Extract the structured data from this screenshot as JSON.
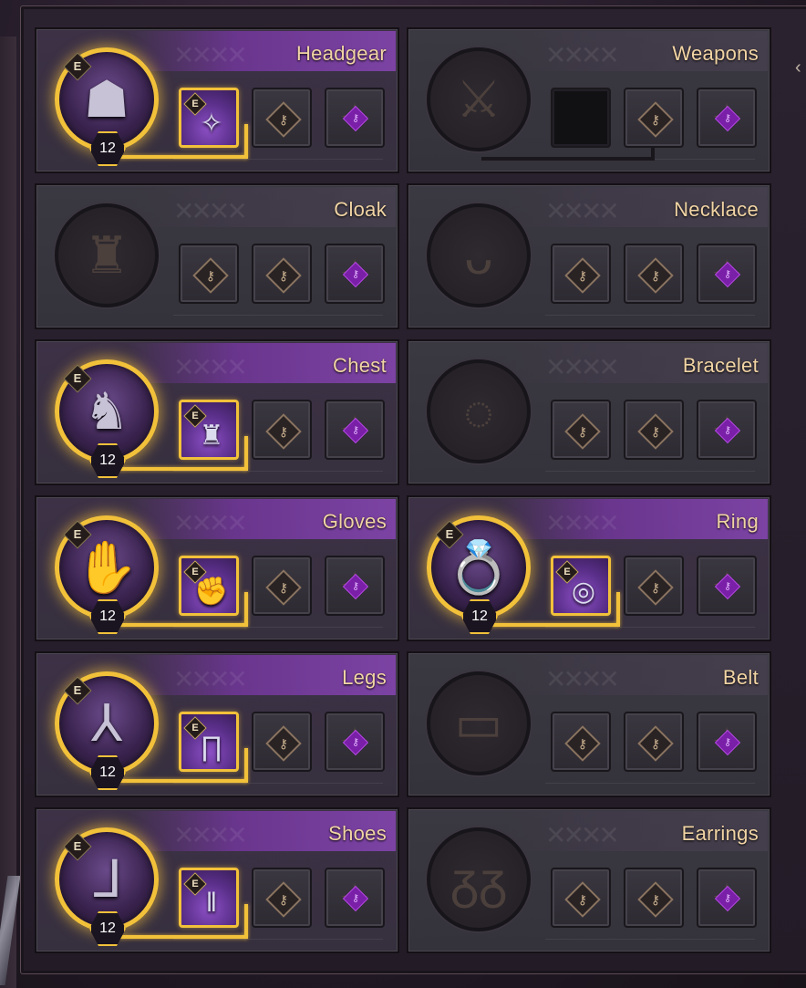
{
  "slots": [
    {
      "title": "Headgear",
      "equipped": true,
      "level": "12",
      "icon": "hood-icon",
      "glyph": "☗",
      "sub_glyph": "✧"
    },
    {
      "title": "Weapons",
      "equipped": false,
      "icon": "crossed-daggers-icon",
      "glyph": "⚔"
    },
    {
      "title": "Cloak",
      "equipped": false,
      "icon": "cloak-icon",
      "glyph": "♜"
    },
    {
      "title": "Necklace",
      "equipped": false,
      "icon": "necklace-icon",
      "glyph": "ᴗ"
    },
    {
      "title": "Chest",
      "equipped": true,
      "level": "12",
      "icon": "chest-armor-icon",
      "glyph": "♞",
      "sub_glyph": "♜"
    },
    {
      "title": "Bracelet",
      "equipped": false,
      "icon": "bracelet-icon",
      "glyph": "◌"
    },
    {
      "title": "Gloves",
      "equipped": true,
      "level": "12",
      "icon": "gauntlet-icon",
      "glyph": "✋",
      "sub_glyph": "✊"
    },
    {
      "title": "Ring",
      "equipped": true,
      "level": "12",
      "icon": "ring-icon",
      "glyph": "💍",
      "sub_glyph": "◎"
    },
    {
      "title": "Legs",
      "equipped": true,
      "level": "12",
      "icon": "pants-icon",
      "glyph": "⅄",
      "sub_glyph": "∏"
    },
    {
      "title": "Belt",
      "equipped": false,
      "icon": "belt-icon",
      "glyph": "▭"
    },
    {
      "title": "Shoes",
      "equipped": true,
      "level": "12",
      "icon": "boots-icon",
      "glyph": "ᒧ",
      "sub_glyph": "ǁ"
    },
    {
      "title": "Earrings",
      "equipped": false,
      "icon": "earrings-icon",
      "glyph": "ᵹᵹ"
    }
  ],
  "badge_letter": "E",
  "keyhole": "⚷",
  "sun_letter": "✦",
  "colors": {
    "accent_gold": "#f2c13a",
    "title_gold": "#f1d4a4",
    "purple": "#7a1fa8"
  }
}
